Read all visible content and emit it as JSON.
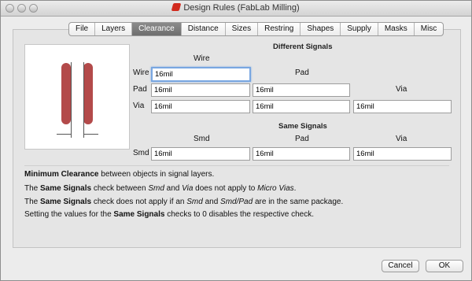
{
  "window": {
    "title": "Design Rules (FabLab Milling)"
  },
  "tabs": [
    "File",
    "Layers",
    "Clearance",
    "Distance",
    "Sizes",
    "Restring",
    "Shapes",
    "Supply",
    "Masks",
    "Misc"
  ],
  "active_tab": "Clearance",
  "different_signals": {
    "heading": "Different Signals",
    "col_wire": "Wire",
    "col_pad": "Pad",
    "col_via": "Via",
    "row_wire_label": "Wire",
    "row_pad_label": "Pad",
    "row_via_label": "Via",
    "wire_wire": "16mil",
    "pad_wire": "16mil",
    "pad_pad": "16mil",
    "via_wire": "16mil",
    "via_pad": "16mil",
    "via_via": "16mil"
  },
  "same_signals": {
    "heading": "Same Signals",
    "col_smd": "Smd",
    "col_pad": "Pad",
    "col_via": "Via",
    "row_smd_label": "Smd",
    "smd_smd": "16mil",
    "smd_pad": "16mil",
    "smd_via": "16mil"
  },
  "info": {
    "line1_bold": "Minimum Clearance",
    "line1_rest": " between objects in signal layers.",
    "line2_pre": "The ",
    "line2_bold": "Same Signals",
    "line2_mid": " check between ",
    "line2_i1": "Smd",
    "line2_and": " and ",
    "line2_i2": "Via",
    "line2_mid2": " does not apply to ",
    "line2_i3": "Micro Vias",
    "line2_end": ".",
    "line3_pre": "The ",
    "line3_bold": "Same Signals",
    "line3_mid": " check does not apply if an ",
    "line3_i1": "Smd",
    "line3_and": " and ",
    "line3_i2": "Smd/Pad",
    "line3_end": " are in the same package.",
    "line4_pre": "Setting the values for the ",
    "line4_bold": "Same Signals",
    "line4_end": " checks to 0 disables the respective check."
  },
  "buttons": {
    "cancel": "Cancel",
    "ok": "OK"
  },
  "colors": {
    "trace": "#b34a4a",
    "active_tab": "#7a7a7a",
    "focus": "#79a7e1"
  }
}
